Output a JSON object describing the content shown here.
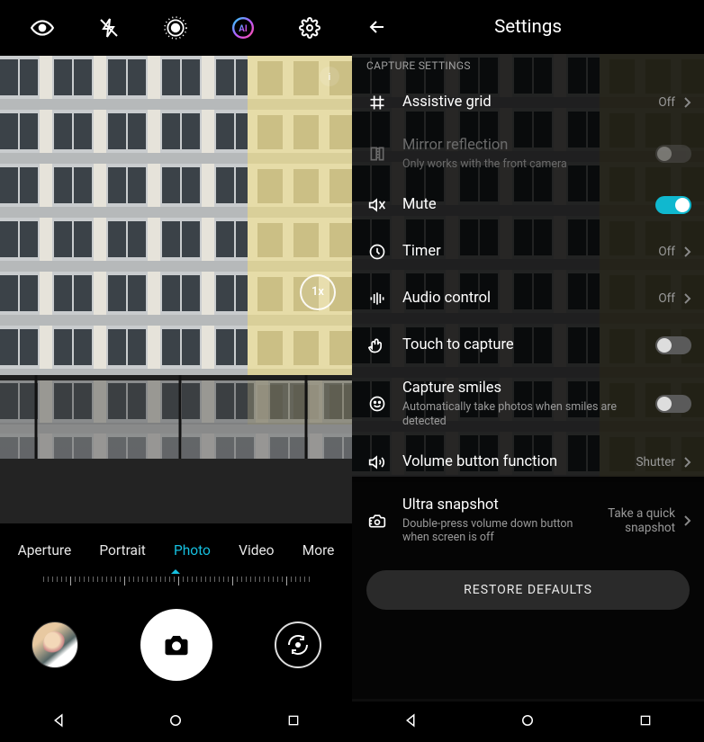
{
  "camera": {
    "zoom_label": "1x",
    "modes": [
      {
        "label": "Aperture",
        "active": false
      },
      {
        "label": "Portrait",
        "active": false
      },
      {
        "label": "Photo",
        "active": true
      },
      {
        "label": "Video",
        "active": false
      },
      {
        "label": "More",
        "active": false
      }
    ],
    "top_icons": [
      "eye-icon",
      "flash-off-icon",
      "target-icon",
      "ai-icon",
      "settings-gear-icon"
    ]
  },
  "settings": {
    "title": "Settings",
    "section_label": "CAPTURE SETTINGS",
    "items": {
      "assistive_grid": {
        "title": "Assistive grid",
        "value": "Off"
      },
      "mirror": {
        "title": "Mirror reflection",
        "sub": "Only works with the front camera"
      },
      "mute": {
        "title": "Mute",
        "on": true
      },
      "timer": {
        "title": "Timer",
        "value": "Off"
      },
      "audio_control": {
        "title": "Audio control",
        "value": "Off"
      },
      "touch_capture": {
        "title": "Touch to capture",
        "on": false
      },
      "capture_smiles": {
        "title": "Capture smiles",
        "sub": "Automatically take photos when smiles are detected",
        "on": false
      },
      "volume_button": {
        "title": "Volume button function",
        "value": "Shutter"
      },
      "ultra_snapshot": {
        "title": "Ultra snapshot",
        "sub": "Double-press volume down button when screen is off",
        "value": "Take a quick snapshot"
      }
    },
    "restore_label": "RESTORE DEFAULTS"
  },
  "colors": {
    "accent": "#10b8cf"
  }
}
